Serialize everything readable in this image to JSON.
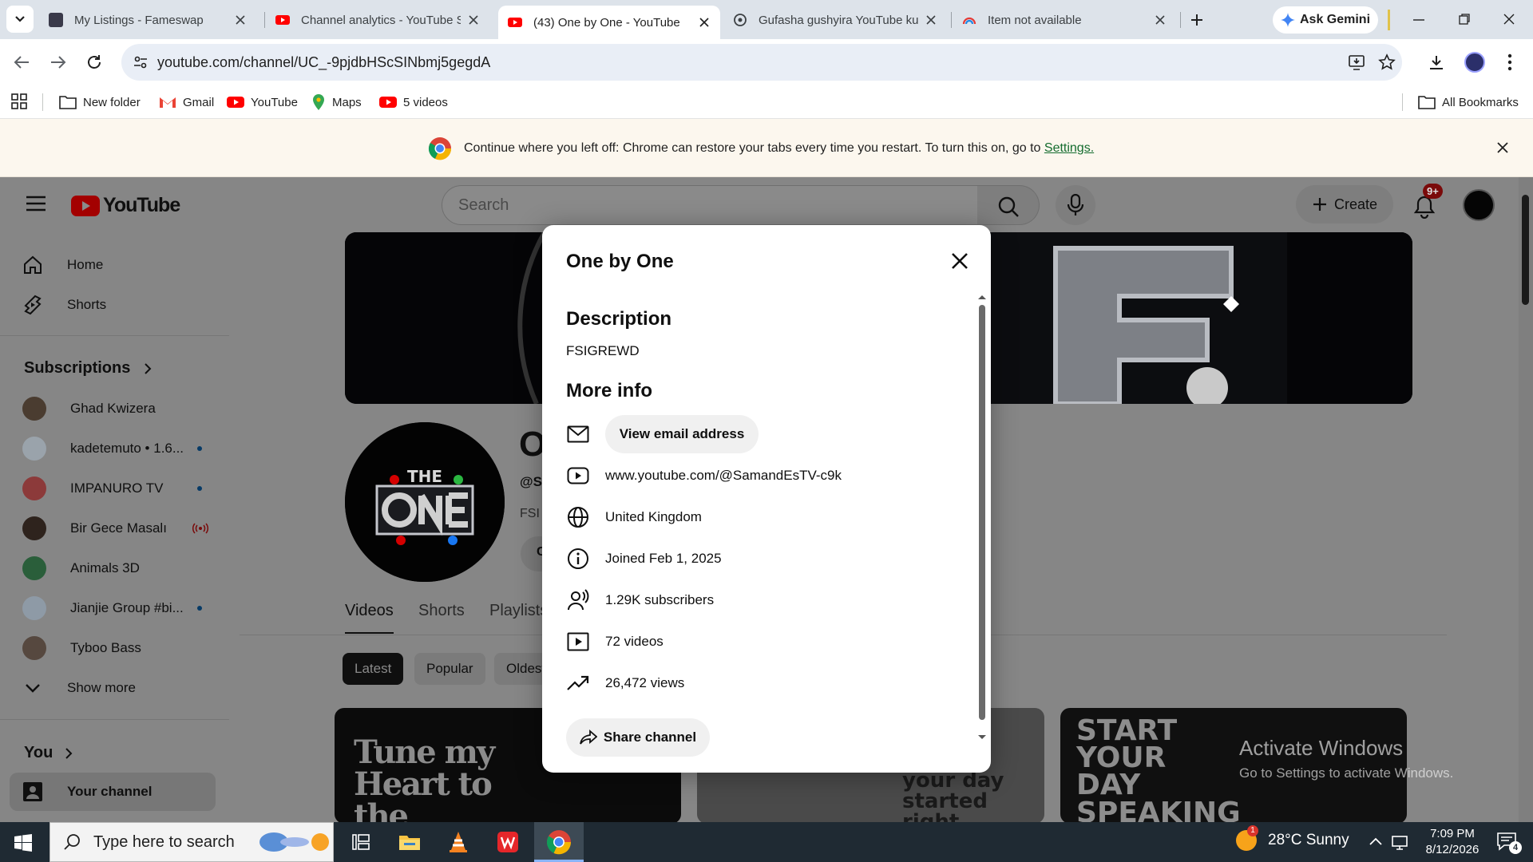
{
  "browser": {
    "tabs": [
      {
        "title": "My Listings - Fameswap"
      },
      {
        "title": "Channel analytics - YouTube Studio"
      },
      {
        "title": "(43) One by One - YouTube"
      },
      {
        "title": "Gufasha gushyira YouTube kuri"
      },
      {
        "title": "Item not available"
      }
    ],
    "ask_gemini": "Ask Gemini",
    "url": "youtube.com/channel/UC_-9pjdbHScSINbmj5gegdA",
    "bookmarks": [
      "New folder",
      "Gmail",
      "YouTube",
      "Maps",
      "5 videos"
    ],
    "all_bookmarks": "All Bookmarks",
    "infobar": {
      "text": "Continue where you left off: Chrome can restore your tabs every time you restart. To turn this on, go to",
      "link": "Settings."
    }
  },
  "youtube": {
    "logo": "YouTube",
    "search_placeholder": "Search",
    "create_label": "Create",
    "notification_badge": "9+",
    "sidebar": {
      "nav": [
        "Home",
        "Shorts"
      ],
      "subscriptions_title": "Subscriptions",
      "subscriptions": [
        {
          "name": "Ghad Kwizera",
          "marker": "",
          "color": "#5a4a3a"
        },
        {
          "name": "kadetemuto • 1.6...",
          "marker": "dot",
          "color": "#b9c3cc"
        },
        {
          "name": "IMPANURO TV",
          "marker": "dot",
          "color": "#c84a4a"
        },
        {
          "name": "Bir Gece Masalı",
          "marker": "live",
          "color": "#3b2d26"
        },
        {
          "name": "Animals 3D",
          "marker": "",
          "color": "#2f7d48"
        },
        {
          "name": "Jianjie Group #bi...",
          "marker": "dot",
          "color": "#a8b6c4"
        },
        {
          "name": "Tyboo Bass",
          "marker": "",
          "color": "#6a5a52"
        }
      ],
      "show_more": "Show more",
      "you_title": "You",
      "your_channel": "Your channel"
    },
    "channel": {
      "name_fragment": "O",
      "handle_fragment": "@S",
      "desc_fragment": "FSI",
      "button_fragment": "C",
      "tabs": [
        "Videos",
        "Shorts",
        "Playlists"
      ],
      "chips": [
        "Latest",
        "Popular",
        "Oldest"
      ],
      "thumbnails": [
        {
          "text": "Tune my Heart to the Rhythm"
        },
        {
          "text": "Getting your day started right"
        },
        {
          "text": "START YOUR DAY SPEAKING"
        }
      ]
    }
  },
  "modal": {
    "title": "One by One",
    "description_heading": "Description",
    "description": "FSIGREWD",
    "more_info_heading": "More info",
    "email_button": "View email address",
    "rows": [
      {
        "icon": "youtube-play-icon",
        "text": "www.youtube.com/@SamandEsTV-c9k"
      },
      {
        "icon": "globe-icon",
        "text": "United Kingdom"
      },
      {
        "icon": "info-icon",
        "text": "Joined Feb 1, 2025"
      },
      {
        "icon": "subscribers-icon",
        "text": "1.29K subscribers"
      },
      {
        "icon": "video-icon",
        "text": "72 videos"
      },
      {
        "icon": "trending-icon",
        "text": "26,472 views"
      }
    ],
    "share_button": "Share channel"
  },
  "watermark": {
    "title": "Activate Windows",
    "subtitle": "Go to Settings to activate Windows."
  },
  "taskbar": {
    "search_placeholder": "Type here to search",
    "weather": "28°C Sunny",
    "weather_badge": "1",
    "time": "7:09 PM",
    "date": "8/12/2026",
    "notifications_count": "4"
  }
}
